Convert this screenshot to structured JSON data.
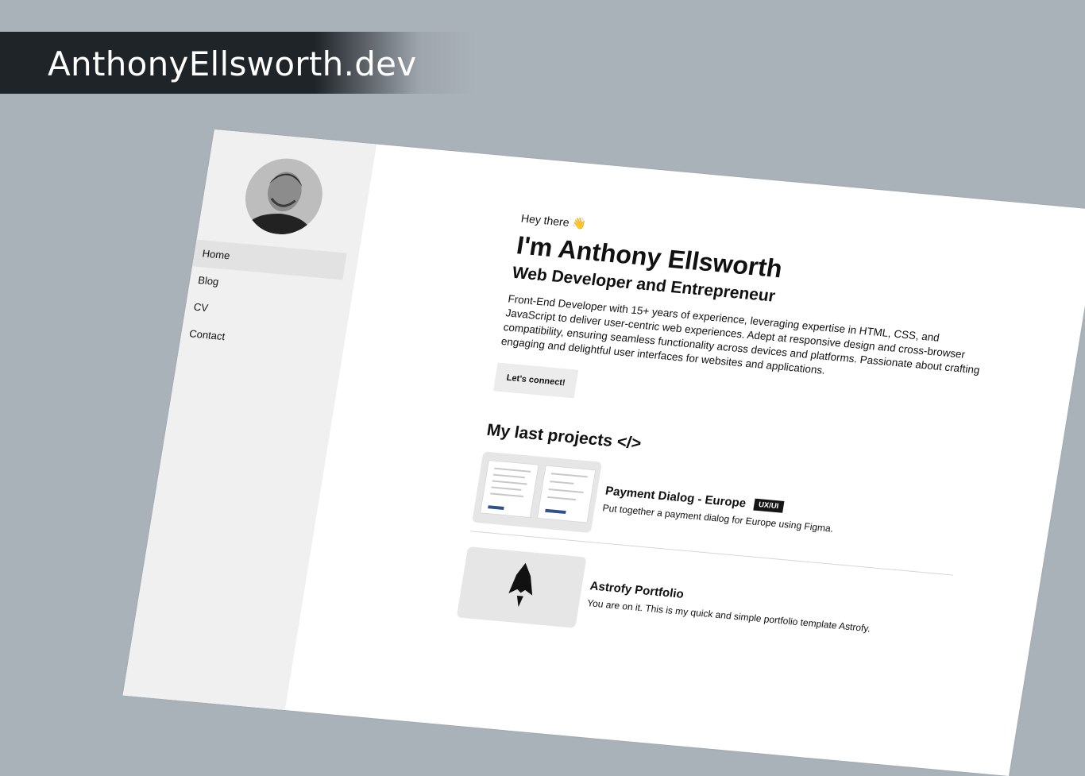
{
  "banner": {
    "title": "AnthonyEllsworth.dev"
  },
  "nav": [
    {
      "label": "Home",
      "active": true
    },
    {
      "label": "Blog"
    },
    {
      "label": "CV"
    },
    {
      "label": "Contact"
    }
  ],
  "hero": {
    "greeting": "Hey there 👋",
    "headline": "I'm Anthony Ellsworth",
    "subhead": "Web Developer and Entrepreneur",
    "bio": "Front-End Developer with 15+ years of experience, leveraging expertise in HTML, CSS, and JavaScript to deliver user-centric web experiences. Adept at responsive design and cross-browser compatibility, ensuring seamless functionality across devices and platforms. Passionate about crafting engaging and delightful user interfaces for websites and applications.",
    "cta_label": "Let's connect!"
  },
  "projects": {
    "section_title": "My last projects </>",
    "items": [
      {
        "name": "Payment Dialog - Europe",
        "tag": "UX/UI",
        "description": "Put together a payment dialog for Europe using Figma.",
        "thumbnail_icon": "payment-dialog-mockup"
      },
      {
        "name": "Astrofy Portfolio",
        "tag": "",
        "description": "You are on it. This is my quick and simple portfolio template Astrofy.",
        "thumbnail_icon": "astro-rocket-logo"
      }
    ]
  },
  "colors": {
    "backdrop": "#a9b1b9",
    "banner": "#1f2428",
    "sidebar": "#f0f0f0",
    "tag_bg": "#151515"
  }
}
